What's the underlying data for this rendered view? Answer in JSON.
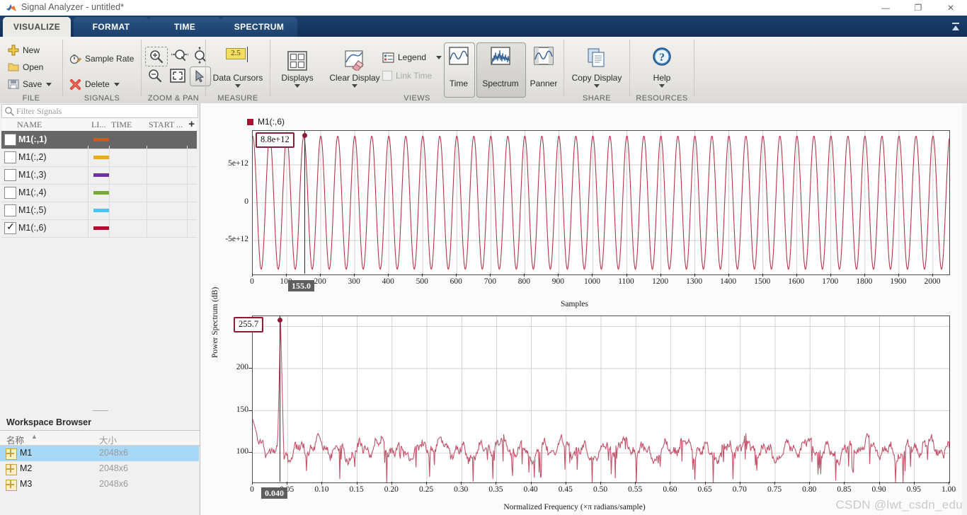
{
  "window": {
    "title": "Signal Analyzer - untitled*",
    "app_icon": "matlab-signal-analyzer-icon",
    "minimize": "—",
    "restore": "❐",
    "close": "✕",
    "collapse_ribbon": "▴"
  },
  "ribbon": {
    "tabs": [
      {
        "label": "VISUALIZE",
        "active": true
      },
      {
        "label": "FORMAT",
        "active": false
      },
      {
        "label": "TIME",
        "active": false
      },
      {
        "label": "SPECTRUM",
        "active": false
      }
    ],
    "groups": [
      {
        "name": "FILE",
        "label": "FILE"
      },
      {
        "name": "SIGNALS",
        "label": "SIGNALS"
      },
      {
        "name": "ZOOM_PAN",
        "label": "ZOOM & PAN"
      },
      {
        "name": "MEASURE",
        "label": "MEASURE"
      },
      {
        "name": "VIEWS",
        "label": "VIEWS"
      },
      {
        "name": "SHARE",
        "label": "SHARE"
      },
      {
        "name": "RESOURCES",
        "label": "RESOURCES"
      }
    ],
    "file": {
      "new": "New",
      "open": "Open",
      "save": "Save"
    },
    "signals": {
      "sample_rate": "Sample Rate",
      "delete": "Delete"
    },
    "zoom_pan": {
      "zoom_in": "zoom-in-icon",
      "zoom_x": "zoom-x-icon",
      "zoom_y": "zoom-y-icon",
      "zoom_out": "zoom-out-icon",
      "fit_to_view": "fit-to-view-icon",
      "pan_select": "pointer-icon"
    },
    "measure": {
      "data_cursors": "Data Cursors",
      "cursor_value": "2.5"
    },
    "views": {
      "displays": "Displays",
      "clear_display": "Clear Display",
      "legend": "Legend",
      "link_time": "Link Time",
      "time": "Time",
      "spectrum": "Spectrum",
      "panner": "Panner"
    },
    "share": {
      "copy_display": "Copy Display"
    },
    "resources": {
      "help": "Help"
    }
  },
  "signals_panel": {
    "filter_placeholder": "Filter Signals",
    "columns": [
      "NAME",
      "LI...",
      "TIME",
      "START ..."
    ],
    "add_column": "+",
    "rows": [
      {
        "name": "M1(:,1)",
        "checked": false,
        "selected": true,
        "color": "#d9541e"
      },
      {
        "name": "M1(:,2)",
        "checked": false,
        "selected": false,
        "color": "#e8a823"
      },
      {
        "name": "M1(:,3)",
        "checked": false,
        "selected": false,
        "color": "#7030a0"
      },
      {
        "name": "M1(:,4)",
        "checked": false,
        "selected": false,
        "color": "#77ac30"
      },
      {
        "name": "M1(:,5)",
        "checked": false,
        "selected": false,
        "color": "#4dc3f0"
      },
      {
        "name": "M1(:,6)",
        "checked": true,
        "selected": false,
        "color": "#a2142f"
      }
    ]
  },
  "workspace_browser": {
    "title": "Workspace Browser",
    "columns": [
      "名称",
      "大小"
    ],
    "sort_arrow": "▲",
    "rows": [
      {
        "name": "M1",
        "size": "2048x6",
        "selected": true
      },
      {
        "name": "M2",
        "size": "2048x6",
        "selected": false
      },
      {
        "name": "M3",
        "size": "2048x6",
        "selected": false
      }
    ]
  },
  "watermark": "CSDN @lwt_csdn_edu",
  "chart_data": [
    {
      "name": "time-plot",
      "type": "line",
      "title": "",
      "xlabel": "Samples",
      "ylabel": "",
      "legend": [
        "M1(:,6)"
      ],
      "legend_colors": [
        "#a2142f"
      ],
      "legend_position": "above-left",
      "grid": true,
      "xlim": [
        0,
        2048
      ],
      "ylim": [
        -9500000000000.0,
        9500000000000.0
      ],
      "xticks": [
        0,
        100,
        200,
        300,
        400,
        500,
        600,
        700,
        800,
        900,
        1000,
        1100,
        1200,
        1300,
        1400,
        1500,
        1600,
        1700,
        1800,
        1900,
        2000
      ],
      "xtick_labels": [
        "0",
        "100",
        "200",
        "300",
        "400",
        "500",
        "600",
        "700",
        "800",
        "900",
        "1000",
        "1100",
        "1200",
        "1300",
        "1400",
        "1500",
        "1600",
        "1700",
        "1800",
        "1900",
        "2000"
      ],
      "yticks": [
        -5000000000000.0,
        0,
        5000000000000.0
      ],
      "ytick_labels": [
        "-5e+12",
        "0",
        "5e+12"
      ],
      "series_description": "Sinusoid, amplitude 8.8e+12, period about 50 samples, 41 visible cycles",
      "series": [
        {
          "name": "M1(:,6)",
          "color": "#a2142f",
          "amplitude": 8800000000000.0,
          "period_samples": 50,
          "phase": 0
        }
      ],
      "cursor": {
        "x_value": "155.0",
        "y_value": "8.8e+12",
        "x_numeric": 155,
        "color": "#8c1b35"
      }
    },
    {
      "name": "spectrum-plot",
      "type": "line",
      "title": "",
      "xlabel": "Normalized Frequency (×π radians/sample)",
      "ylabel": "Power Spectrum (dB)",
      "grid": true,
      "xlim": [
        0,
        1.0
      ],
      "ylim": [
        65,
        262
      ],
      "xticks": [
        0,
        0.05,
        0.1,
        0.15,
        0.2,
        0.25,
        0.3,
        0.35,
        0.4,
        0.45,
        0.5,
        0.55,
        0.6,
        0.65,
        0.7,
        0.75,
        0.8,
        0.85,
        0.9,
        0.95,
        1.0
      ],
      "xtick_labels": [
        "0",
        "0.05",
        "0.10",
        "0.15",
        "0.20",
        "0.25",
        "0.30",
        "0.35",
        "0.40",
        "0.45",
        "0.50",
        "0.55",
        "0.60",
        "0.65",
        "0.70",
        "0.75",
        "0.80",
        "0.85",
        "0.90",
        "0.95",
        "1.00"
      ],
      "yticks": [
        100,
        150,
        200,
        250
      ],
      "ytick_labels": [
        "100",
        "150",
        "200",
        "250"
      ],
      "series_description": "Power spectrum with a single dominant peak at 0.040 reaching 255.7 dB; noise floor fluctuates around 100-110 dB across the rest of the band",
      "series": [
        {
          "name": "M1(:,6)",
          "color": "#bf4a62",
          "peak_x": 0.04,
          "peak_y": 255.7,
          "noise_floor_db": 104
        }
      ],
      "cursor": {
        "x_value": "0.040",
        "y_value": "255.7",
        "x_numeric": 0.04,
        "color": "#8c1b35"
      }
    }
  ]
}
